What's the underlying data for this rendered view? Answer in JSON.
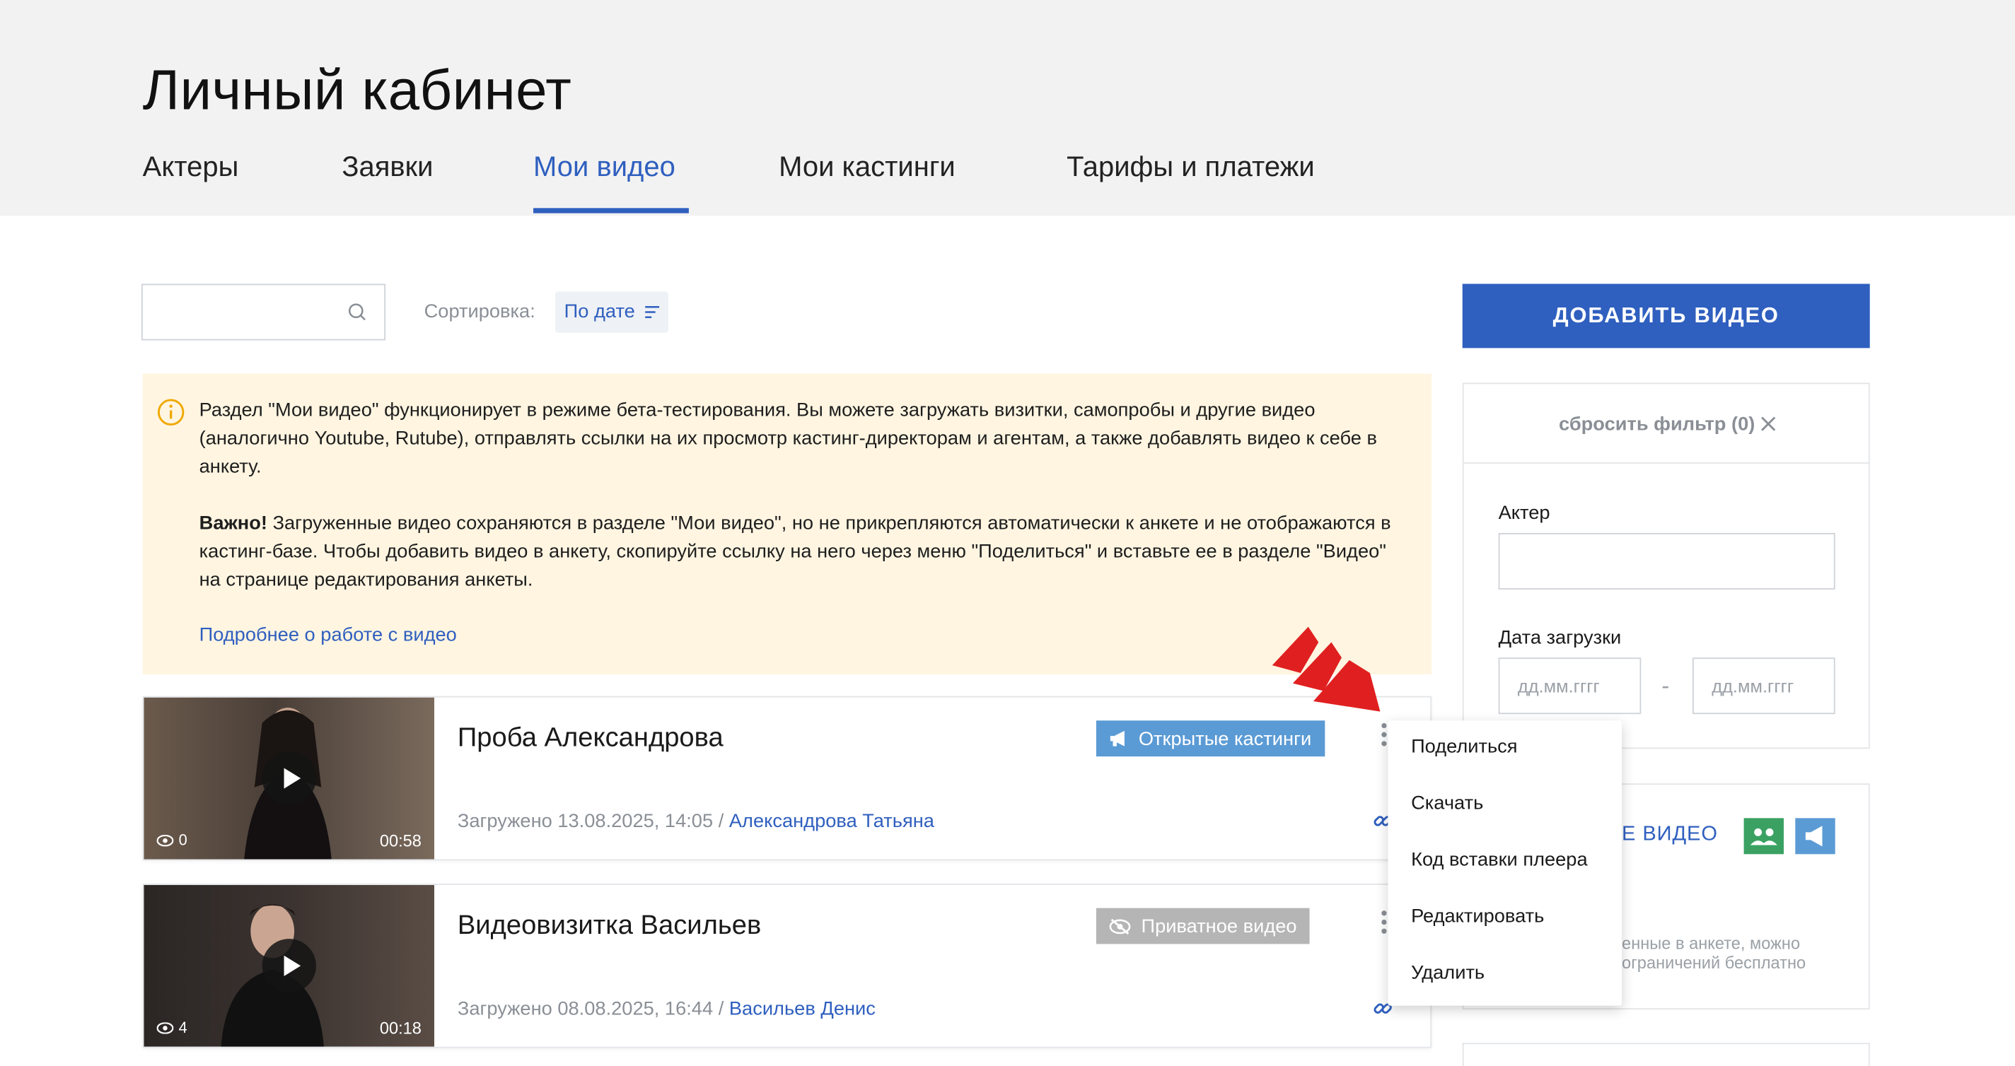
{
  "header": {
    "title": "Личный кабинет",
    "tabs": [
      {
        "label": "Актеры"
      },
      {
        "label": "Заявки"
      },
      {
        "label": "Мои видео",
        "active": true
      },
      {
        "label": "Мои кастинги"
      },
      {
        "label": "Тарифы и платежи"
      }
    ]
  },
  "toolbar": {
    "search_placeholder": "",
    "sort_label": "Сортировка:",
    "sort_value": "По дате"
  },
  "banner": {
    "paragraph1": "Раздел \"Мои видео\" функционирует в режиме бета-тестирования. Вы можете загружать визитки, самопробы и другие видео (аналогично Youtube, Rutube), отправлять ссылки на их просмотр кастинг-директорам и агентам, а также добавлять видео к себе в анкету.",
    "important_label": "Важно!",
    "paragraph2": " Загруженные видео сохраняются в разделе \"Мои видео\", но не прикрепляются автоматически к анкете и не отображаются в кастинг-базе. Чтобы добавить видео в анкету, скопируйте ссылку на него через меню \"Поделиться\" и вставьте ее в разделе \"Видео\" на странице редактирования анкеты.",
    "link": "Подробнее о работе с видео"
  },
  "videos": [
    {
      "title": "Проба Александрова",
      "uploaded": "Загружено 13.08.2025, 14:05 /",
      "author": "Александрова Татьяна",
      "views": "0",
      "duration": "00:58",
      "badge": "Открытые кастинги"
    },
    {
      "title": "Видеовизитка Васильев",
      "uploaded": "Загружено 08.08.2025, 16:44 /",
      "author": "Васильев Денис",
      "views": "4",
      "duration": "00:18",
      "badge": "Приватное видео"
    }
  ],
  "sidebar": {
    "add_button": "ДОБАВИТЬ ВИДЕО",
    "reset_filter": "сбросить фильтр (0)",
    "actor_label": "Актер",
    "actor_value": "",
    "date_label": "Дата загрузки",
    "date_from_placeholder": "дд.мм.гггг",
    "date_to_placeholder": "дд.мм.гггг",
    "date_separator": "-",
    "card2_link": "Е ВИДЕО",
    "card2_note_line1": "енные в анкете, можно",
    "card2_note_line2": "ограничений бесплатно"
  },
  "dropdown": {
    "items": [
      "Поделиться",
      "Скачать",
      "Код вставки плеера",
      "Редактировать",
      "Удалить"
    ]
  },
  "colors": {
    "accent": "#2f5fbf",
    "banner_bg": "#fff5e1",
    "badge_open": "#5b9bd5",
    "badge_private": "#b5b5b5",
    "chip_green": "#3aa163",
    "annotation_red": "#e02020"
  }
}
